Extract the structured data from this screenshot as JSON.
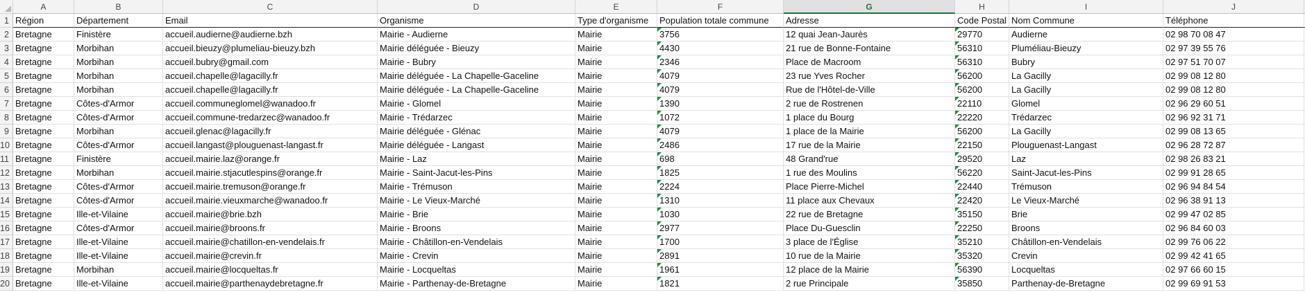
{
  "spreadsheet": {
    "column_letters": [
      "A",
      "B",
      "C",
      "D",
      "E",
      "F",
      "G",
      "H",
      "I",
      "J"
    ],
    "selected_column": "G",
    "header": [
      "Région",
      "Département",
      "Email",
      "Organisme",
      "Type d'organisme",
      "Population totale commune",
      "Adresse",
      "Code Postal",
      "Nom Commune",
      "Téléphone"
    ],
    "rows": [
      [
        "Bretagne",
        "Finistère",
        "accueil.audierne@audierne.bzh",
        "Mairie - Audierne",
        "Mairie",
        "3756",
        "12 quai Jean-Jaurès",
        "29770",
        "Audierne",
        "02 98 70 08 47"
      ],
      [
        "Bretagne",
        "Morbihan",
        "accueil.bieuzy@plumeliau-bieuzy.bzh",
        "Mairie déléguée - Bieuzy",
        "Mairie",
        "4430",
        "21 rue de Bonne-Fontaine",
        "56310",
        "Pluméliau-Bieuzy",
        "02 97 39 55 76"
      ],
      [
        "Bretagne",
        "Morbihan",
        "accueil.bubry@gmail.com",
        "Mairie - Bubry",
        "Mairie",
        "2346",
        "Place de Macroom",
        "56310",
        "Bubry",
        "02 97 51 70 07"
      ],
      [
        "Bretagne",
        "Morbihan",
        "accueil.chapelle@lagacilly.fr",
        "Mairie déléguée - La Chapelle-Gaceline",
        "Mairie",
        "4079",
        "23 rue Yves Rocher",
        "56200",
        "La Gacilly",
        "02 99 08 12 80"
      ],
      [
        "Bretagne",
        "Morbihan",
        "accueil.chapelle@lagacilly.fr",
        "Mairie déléguée - La Chapelle-Gaceline",
        "Mairie",
        "4079",
        "Rue de l'Hôtel-de-Ville",
        "56200",
        "La Gacilly",
        "02 99 08 12 80"
      ],
      [
        "Bretagne",
        "Côtes-d'Armor",
        "accueil.communeglomel@wanadoo.fr",
        "Mairie - Glomel",
        "Mairie",
        "1390",
        "2 rue de Rostrenen",
        "22110",
        "Glomel",
        "02 96 29 60 51"
      ],
      [
        "Bretagne",
        "Côtes-d'Armor",
        "accueil.commune-tredarzec@wanadoo.fr",
        "Mairie - Trédarzec",
        "Mairie",
        "1072",
        "1 place du Bourg",
        "22220",
        "Trédarzec",
        "02 96 92 31 71"
      ],
      [
        "Bretagne",
        "Morbihan",
        "accueil.glenac@lagacilly.fr",
        "Mairie déléguée - Glénac",
        "Mairie",
        "4079",
        "1 place de la Mairie",
        "56200",
        "La Gacilly",
        "02 99 08 13 65"
      ],
      [
        "Bretagne",
        "Côtes-d'Armor",
        "accueil.langast@plouguenast-langast.fr",
        "Mairie déléguée - Langast",
        "Mairie",
        "2486",
        "17 rue de la Mairie",
        "22150",
        "Plouguenast-Langast",
        "02 96 28 72 87"
      ],
      [
        "Bretagne",
        "Finistère",
        "accueil.mairie.laz@orange.fr",
        "Mairie - Laz",
        "Mairie",
        "698",
        "48 Grand'rue",
        "29520",
        "Laz",
        "02 98 26 83 21"
      ],
      [
        "Bretagne",
        "Morbihan",
        "accueil.mairie.stjacutlespins@orange.fr",
        "Mairie - Saint-Jacut-les-Pins",
        "Mairie",
        "1825",
        "1 rue des Moulins",
        "56220",
        "Saint-Jacut-les-Pins",
        "02 99 91 28 65"
      ],
      [
        "Bretagne",
        "Côtes-d'Armor",
        "accueil.mairie.tremuson@orange.fr",
        "Mairie - Trémuson",
        "Mairie",
        "2224",
        "Place Pierre-Michel",
        "22440",
        "Trémuson",
        "02 96 94 84 54"
      ],
      [
        "Bretagne",
        "Côtes-d'Armor",
        "accueil.mairie.vieuxmarche@wanadoo.fr",
        "Mairie - Le Vieux-Marché",
        "Mairie",
        "1310",
        "11 place aux Chevaux",
        "22420",
        "Le Vieux-Marché",
        "02 96 38 91 13"
      ],
      [
        "Bretagne",
        "Ille-et-Vilaine",
        "accueil.mairie@brie.bzh",
        "Mairie - Brie",
        "Mairie",
        "1030",
        "22 rue de Bretagne",
        "35150",
        "Brie",
        "02 99 47 02 85"
      ],
      [
        "Bretagne",
        "Côtes-d'Armor",
        "accueil.mairie@broons.fr",
        "Mairie - Broons",
        "Mairie",
        "2977",
        "Place Du-Guesclin",
        "22250",
        "Broons",
        "02 96 84 60 03"
      ],
      [
        "Bretagne",
        "Ille-et-Vilaine",
        "accueil.mairie@chatillon-en-vendelais.fr",
        "Mairie - Châtillon-en-Vendelais",
        "Mairie",
        "1700",
        "3 place de l'Église",
        "35210",
        "Châtillon-en-Vendelais",
        "02 99 76 06 22"
      ],
      [
        "Bretagne",
        "Ille-et-Vilaine",
        "accueil.mairie@crevin.fr",
        "Mairie - Crevin",
        "Mairie",
        "2891",
        "10 rue de la Mairie",
        "35320",
        "Crevin",
        "02 99 42 41 65"
      ],
      [
        "Bretagne",
        "Morbihan",
        "accueil.mairie@locqueltas.fr",
        "Mairie - Locqueltas",
        "Mairie",
        "1961",
        "12 place de la Mairie",
        "56390",
        "Locqueltas",
        "02 97 66 60 15"
      ],
      [
        "Bretagne",
        "Ille-et-Vilaine",
        "accueil.mairie@parthenaydebretagne.fr",
        "Mairie - Parthenay-de-Bretagne",
        "Mairie",
        "1821",
        "2 rue Principale",
        "35850",
        "Parthenay-de-Bretagne",
        "02 99 69 91 53"
      ]
    ]
  }
}
